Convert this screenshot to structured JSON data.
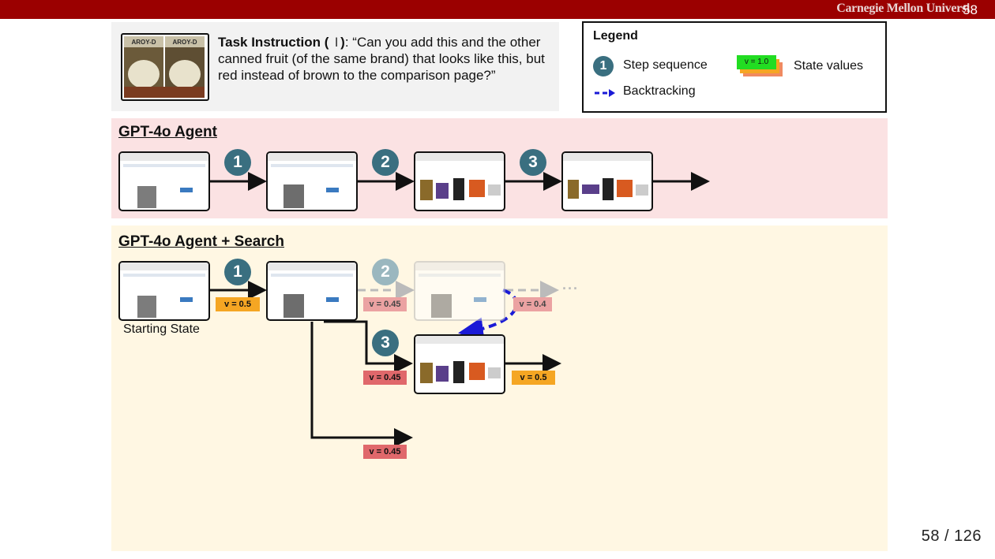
{
  "header": {
    "institution": "Carnegie Mellon Universi",
    "overlay_number": "58"
  },
  "task": {
    "label": "Task Instruction (",
    "close_paren": ")",
    "text": ": “Can you add this and the other canned fruit (of the same brand) that looks like this, but red instead of brown to the comparison page?”",
    "image_brand_text": "AROY-D"
  },
  "legend": {
    "title": "Legend",
    "badge_number": "1",
    "step_label": "Step sequence",
    "backtracking_label": "Backtracking",
    "state_values_label": "State values",
    "sample_value": "v = 1.0"
  },
  "sections": {
    "baseline_title": "GPT-4o Agent",
    "search_title": "GPT-4o Agent + Search"
  },
  "baseline_steps": [
    "1",
    "2",
    "3"
  ],
  "search": {
    "steps": [
      "1",
      "2",
      "3"
    ],
    "values": {
      "start": "v = 0.5",
      "step2_faded": "v = 0.45",
      "step2_next": "v = 0.4",
      "step3_in": "v = 0.45",
      "step3_out": "v = 0.5",
      "branch_bottom": "v = 0.45"
    },
    "ellipsis": "···",
    "starting_state_label": "Starting State"
  },
  "colors": {
    "accent_bar": "#9b0000",
    "badge": "#3a6f80",
    "backtrack": "#1a1ad6",
    "value_high": "#f5a623",
    "value_low": "#e0686b"
  },
  "footer": {
    "page": "58 / 126"
  }
}
